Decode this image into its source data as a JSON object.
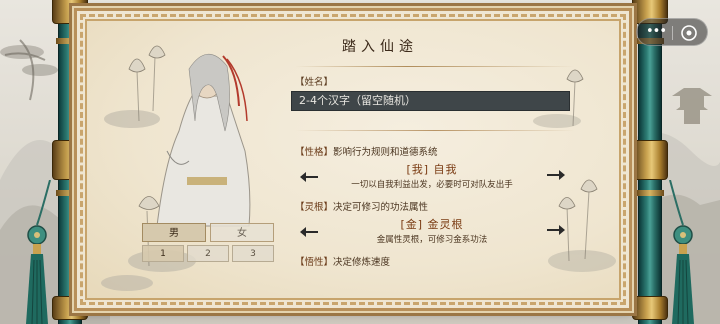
{
  "screen_title": "踏入仙途",
  "name_field": {
    "label": "【姓名】",
    "placeholder": "2-4个汉字（留空随机）"
  },
  "personality": {
    "label": "【性格】",
    "description": "影响行为规则和道德系统",
    "selected_title": "[我] 自我",
    "selected_desc": "一切以自我利益出发，必要时可对队友出手"
  },
  "spirit_root": {
    "label": "【灵根】",
    "description": "决定可修习的功法属性",
    "selected_title": "[金] 金灵根",
    "selected_desc": "金属性灵根，可修习金系功法"
  },
  "aptitude": {
    "label": "【悟性】",
    "description": "决定修炼速度"
  },
  "gender": {
    "options": [
      "男",
      "女"
    ],
    "selected": "男"
  },
  "portrait_slots": {
    "options": [
      "1",
      "2",
      "3"
    ],
    "selected": "1"
  },
  "capsule": {
    "more_icon": "more-dots-icon",
    "close_icon": "target-close-icon"
  },
  "colors": {
    "parchment": "#efe6d2",
    "roller_jade": "#2d7c74",
    "accent_text": "#7a3b12",
    "input_bg": "#3f4649"
  }
}
